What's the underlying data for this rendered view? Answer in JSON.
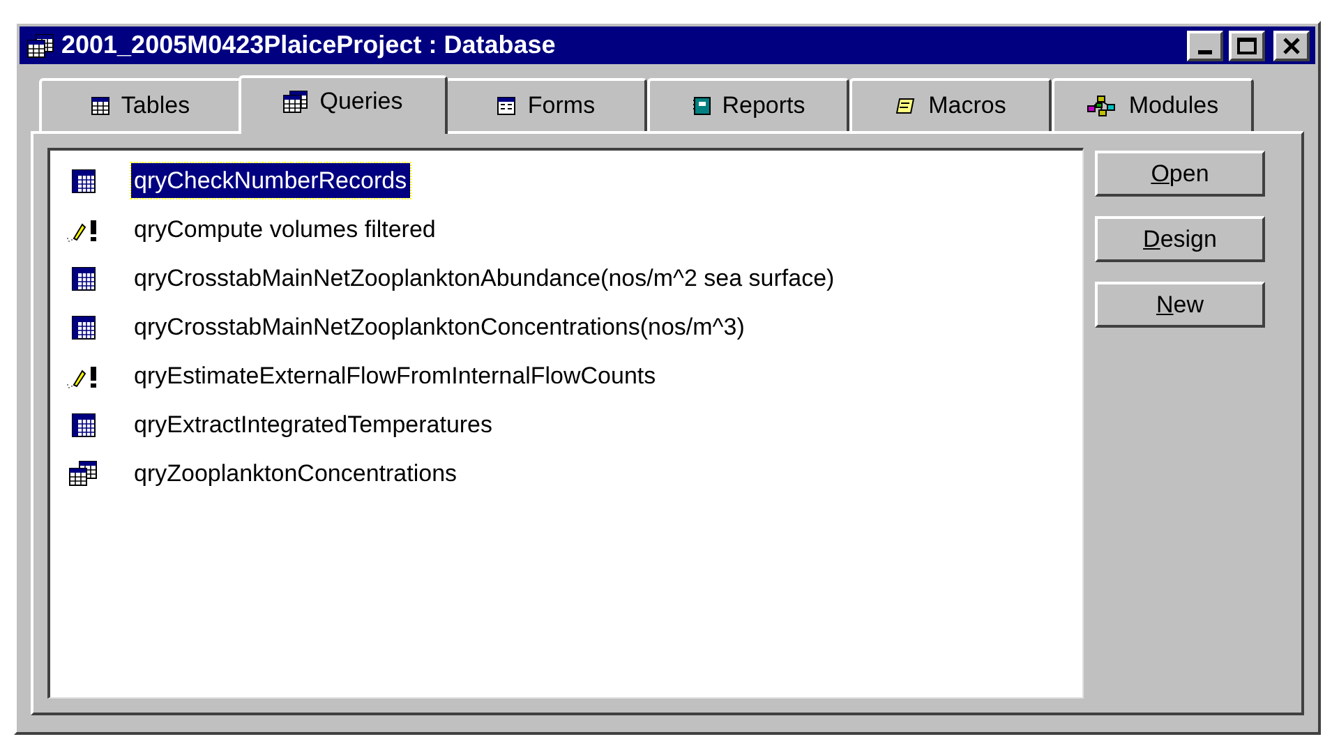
{
  "window": {
    "title": "2001_2005M0423PlaiceProject : Database"
  },
  "tabs": [
    {
      "label": "Tables",
      "kind": "tables",
      "selected": false
    },
    {
      "label": "Queries",
      "kind": "queries",
      "selected": true
    },
    {
      "label": "Forms",
      "kind": "forms",
      "selected": false
    },
    {
      "label": "Reports",
      "kind": "reports",
      "selected": false
    },
    {
      "label": "Macros",
      "kind": "macros",
      "selected": false
    },
    {
      "label": "Modules",
      "kind": "modules",
      "selected": false
    }
  ],
  "queries": [
    {
      "name": "qryCheckNumberRecords",
      "kind": "datasheet",
      "selected": true
    },
    {
      "name": "qryCompute volumes filtered",
      "kind": "action",
      "selected": false
    },
    {
      "name": "qryCrosstabMainNetZooplanktonAbundance(nos/m^2 sea surface)",
      "kind": "datasheet",
      "selected": false
    },
    {
      "name": "qryCrosstabMainNetZooplanktonConcentrations(nos/m^3)",
      "kind": "datasheet",
      "selected": false
    },
    {
      "name": "qryEstimateExternalFlowFromInternalFlowCounts",
      "kind": "action",
      "selected": false
    },
    {
      "name": "qryExtractIntegratedTemperatures",
      "kind": "datasheet",
      "selected": false
    },
    {
      "name": "qryZooplanktonConcentrations",
      "kind": "stacked",
      "selected": false
    }
  ],
  "buttons": [
    "Open",
    "Design",
    "New"
  ]
}
